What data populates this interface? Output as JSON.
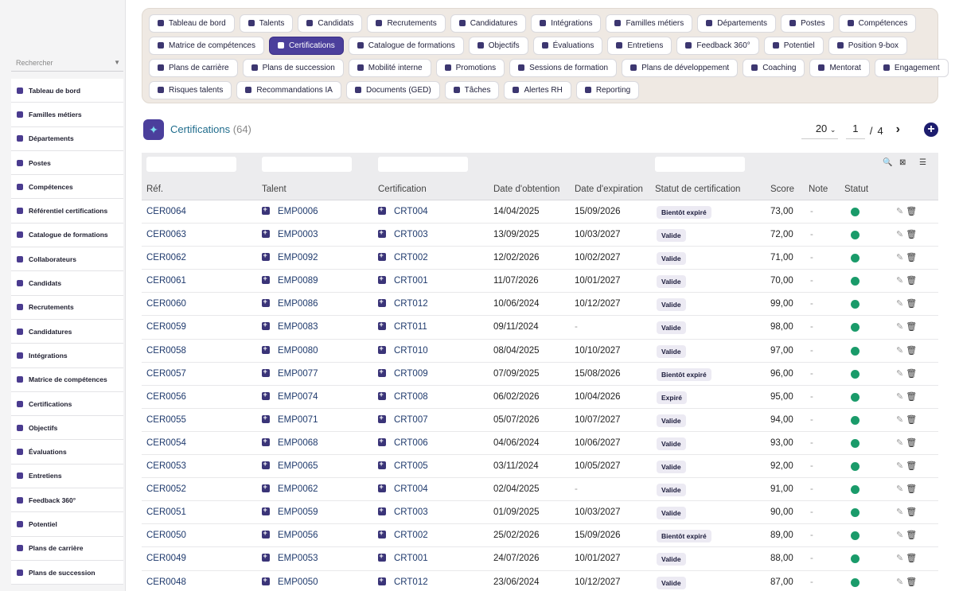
{
  "sidebar": {
    "search_placeholder": "Rechercher",
    "items": [
      {
        "label": "Tableau de bord",
        "icon": "dashboard-icon"
      },
      {
        "label": "Familles métiers",
        "icon": "sitemap-icon"
      },
      {
        "label": "Départements",
        "icon": "building-icon"
      },
      {
        "label": "Postes",
        "icon": "badge-icon"
      },
      {
        "label": "Compétences",
        "icon": "brain-icon"
      },
      {
        "label": "Référentiel certifications",
        "icon": "certificate-icon"
      },
      {
        "label": "Catalogue de formations",
        "icon": "graduation-cap-icon"
      },
      {
        "label": "Collaborateurs",
        "icon": "user-icon"
      },
      {
        "label": "Candidats",
        "icon": "user-plus-icon"
      },
      {
        "label": "Recrutements",
        "icon": "megaphone-icon"
      },
      {
        "label": "Candidatures",
        "icon": "file-signature-icon"
      },
      {
        "label": "Intégrations",
        "icon": "building-user-icon"
      },
      {
        "label": "Matrice de compétences",
        "icon": "sitemap-icon"
      },
      {
        "label": "Certifications",
        "icon": "award-icon"
      },
      {
        "label": "Objectifs",
        "icon": "target-icon"
      },
      {
        "label": "Évaluations",
        "icon": "star-icon"
      },
      {
        "label": "Entretiens",
        "icon": "comments-icon"
      },
      {
        "label": "Feedback 360°",
        "icon": "comment-dots-icon"
      },
      {
        "label": "Potentiel",
        "icon": "chart-line-icon"
      },
      {
        "label": "Plans de carrière",
        "icon": "route-icon"
      },
      {
        "label": "Plans de succession",
        "icon": "sitemap-icon"
      }
    ]
  },
  "chips": [
    [
      "Tableau de bord",
      "Talents",
      "Candidats",
      "Recrutements",
      "Candidatures",
      "Intégrations",
      "Familles métiers",
      "Départements",
      "Postes",
      "Compétences"
    ],
    [
      "Matrice de compétences",
      "Certifications",
      "Catalogue de formations",
      "Objectifs",
      "Évaluations",
      "Entretiens",
      "Feedback 360°",
      "Potentiel",
      "Position 9-box"
    ],
    [
      "Plans de carrière",
      "Plans de succession",
      "Mobilité interne",
      "Promotions",
      "Sessions de formation",
      "Plans de développement",
      "Coaching",
      "Mentorat",
      "Engagement"
    ],
    [
      "Risques talents",
      "Recommandations IA",
      "Documents (GED)",
      "Tâches",
      "Alertes RH",
      "Reporting"
    ]
  ],
  "active_chip": "Certifications",
  "header": {
    "title": "Certifications",
    "count": "(64)",
    "page_size": "20",
    "page": "1",
    "page_sep": "/",
    "page_total": "4",
    "next": "›",
    "add": "+"
  },
  "table": {
    "columns": [
      "Réf.",
      "Talent",
      "Certification",
      "Date d'obtention",
      "Date d'expiration",
      "Statut de certification",
      "Score",
      "Note",
      "Statut"
    ],
    "rows": [
      [
        "CER0064",
        "EMP0006",
        "CRT004",
        "14/04/2025",
        "15/09/2026",
        "Bientôt expiré",
        "73,00",
        "-"
      ],
      [
        "CER0063",
        "EMP0003",
        "CRT003",
        "13/09/2025",
        "10/03/2027",
        "Valide",
        "72,00",
        "-"
      ],
      [
        "CER0062",
        "EMP0092",
        "CRT002",
        "12/02/2026",
        "10/02/2027",
        "Valide",
        "71,00",
        "-"
      ],
      [
        "CER0061",
        "EMP0089",
        "CRT001",
        "11/07/2026",
        "10/01/2027",
        "Valide",
        "70,00",
        "-"
      ],
      [
        "CER0060",
        "EMP0086",
        "CRT012",
        "10/06/2024",
        "10/12/2027",
        "Valide",
        "99,00",
        "-"
      ],
      [
        "CER0059",
        "EMP0083",
        "CRT011",
        "09/11/2024",
        "-",
        "Valide",
        "98,00",
        "-"
      ],
      [
        "CER0058",
        "EMP0080",
        "CRT010",
        "08/04/2025",
        "10/10/2027",
        "Valide",
        "97,00",
        "-"
      ],
      [
        "CER0057",
        "EMP0077",
        "CRT009",
        "07/09/2025",
        "15/08/2026",
        "Bientôt expiré",
        "96,00",
        "-"
      ],
      [
        "CER0056",
        "EMP0074",
        "CRT008",
        "06/02/2026",
        "10/04/2026",
        "Expiré",
        "95,00",
        "-"
      ],
      [
        "CER0055",
        "EMP0071",
        "CRT007",
        "05/07/2026",
        "10/07/2027",
        "Valide",
        "94,00",
        "-"
      ],
      [
        "CER0054",
        "EMP0068",
        "CRT006",
        "04/06/2024",
        "10/06/2027",
        "Valide",
        "93,00",
        "-"
      ],
      [
        "CER0053",
        "EMP0065",
        "CRT005",
        "03/11/2024",
        "10/05/2027",
        "Valide",
        "92,00",
        "-"
      ],
      [
        "CER0052",
        "EMP0062",
        "CRT004",
        "02/04/2025",
        "-",
        "Valide",
        "91,00",
        "-"
      ],
      [
        "CER0051",
        "EMP0059",
        "CRT003",
        "01/09/2025",
        "10/03/2027",
        "Valide",
        "90,00",
        "-"
      ],
      [
        "CER0050",
        "EMP0056",
        "CRT002",
        "25/02/2026",
        "15/09/2026",
        "Bientôt expiré",
        "89,00",
        "-"
      ],
      [
        "CER0049",
        "EMP0053",
        "CRT001",
        "24/07/2026",
        "10/01/2027",
        "Valide",
        "88,00",
        "-"
      ],
      [
        "CER0048",
        "EMP0050",
        "CRT012",
        "23/06/2024",
        "10/12/2027",
        "Valide",
        "87,00",
        "-"
      ]
    ]
  },
  "colors": {
    "accent": "#4b3f9c",
    "status_active": "#1a9b6a",
    "title": "#1f6c8c"
  }
}
